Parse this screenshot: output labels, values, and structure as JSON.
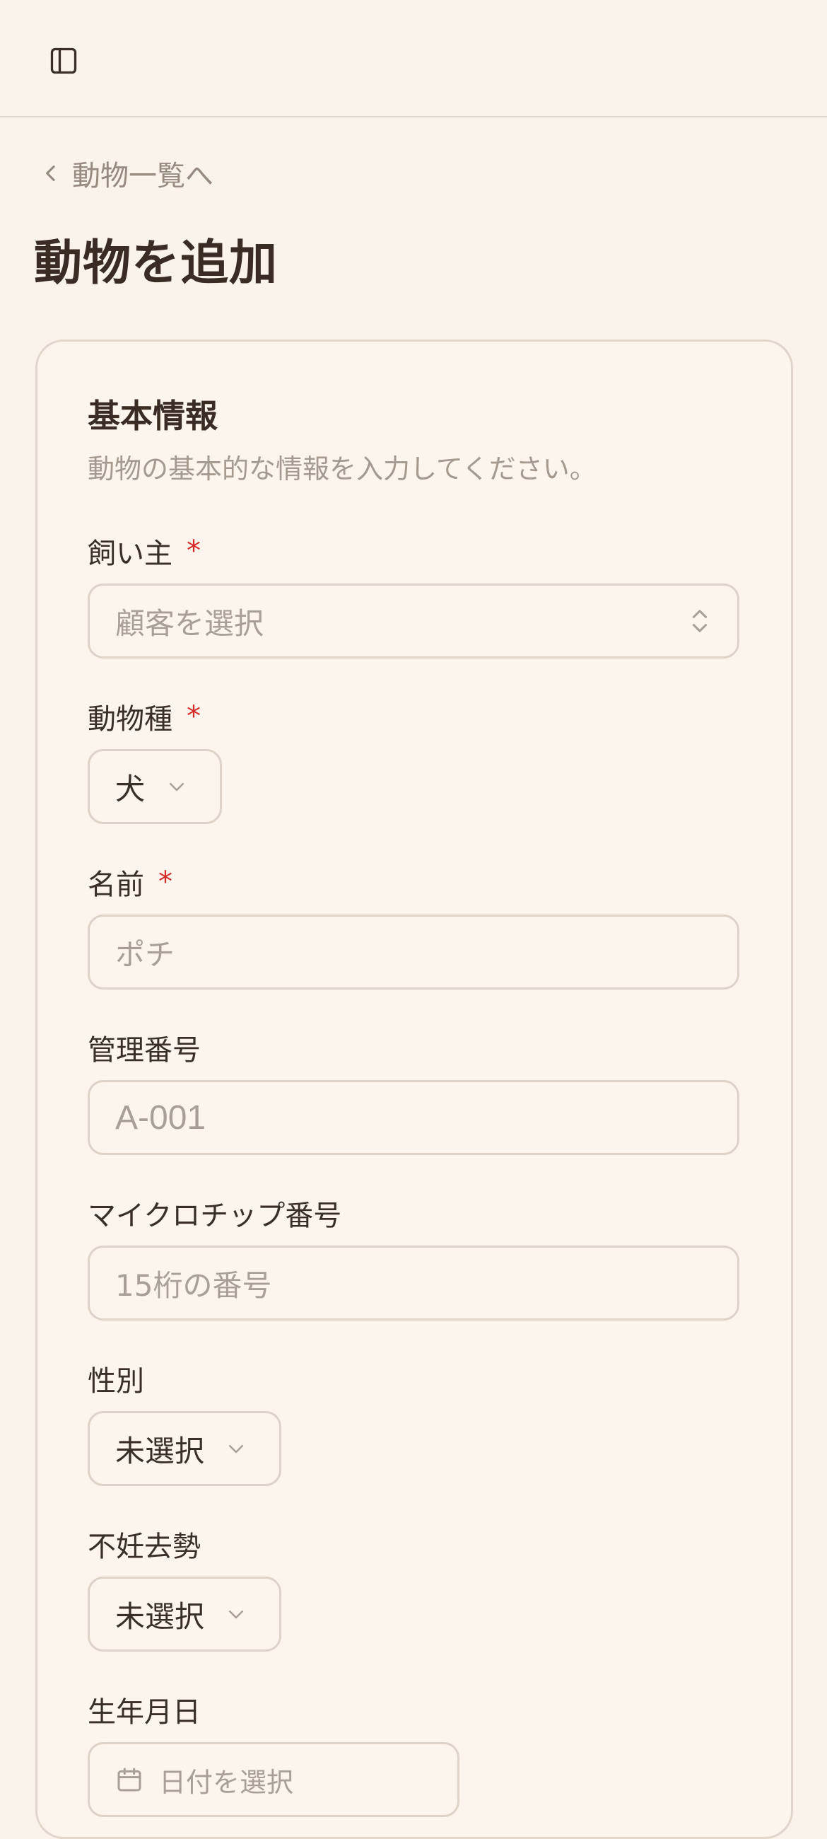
{
  "header": {
    "toggle_icon": "sidebar-toggle-icon"
  },
  "breadcrumb": {
    "back_label": "動物一覧へ"
  },
  "page": {
    "title": "動物を追加"
  },
  "section": {
    "title": "基本情報",
    "description": "動物の基本的な情報を入力してください。"
  },
  "fields": {
    "owner": {
      "label": "飼い主",
      "required_mark": "*",
      "placeholder": "顧客を選択"
    },
    "species": {
      "label": "動物種",
      "required_mark": "*",
      "value": "犬"
    },
    "name": {
      "label": "名前",
      "required_mark": "*",
      "placeholder": "ポチ"
    },
    "control_number": {
      "label": "管理番号",
      "placeholder": "A-001"
    },
    "microchip": {
      "label": "マイクロチップ番号",
      "placeholder": "15桁の番号"
    },
    "sex": {
      "label": "性別",
      "value": "未選択"
    },
    "neuter": {
      "label": "不妊去勢",
      "value": "未選択"
    },
    "birthdate": {
      "label": "生年月日",
      "placeholder": "日付を選択"
    }
  },
  "colors": {
    "background": "#faf3ea",
    "required": "#d42a2a",
    "placeholder": "#a8a097"
  }
}
